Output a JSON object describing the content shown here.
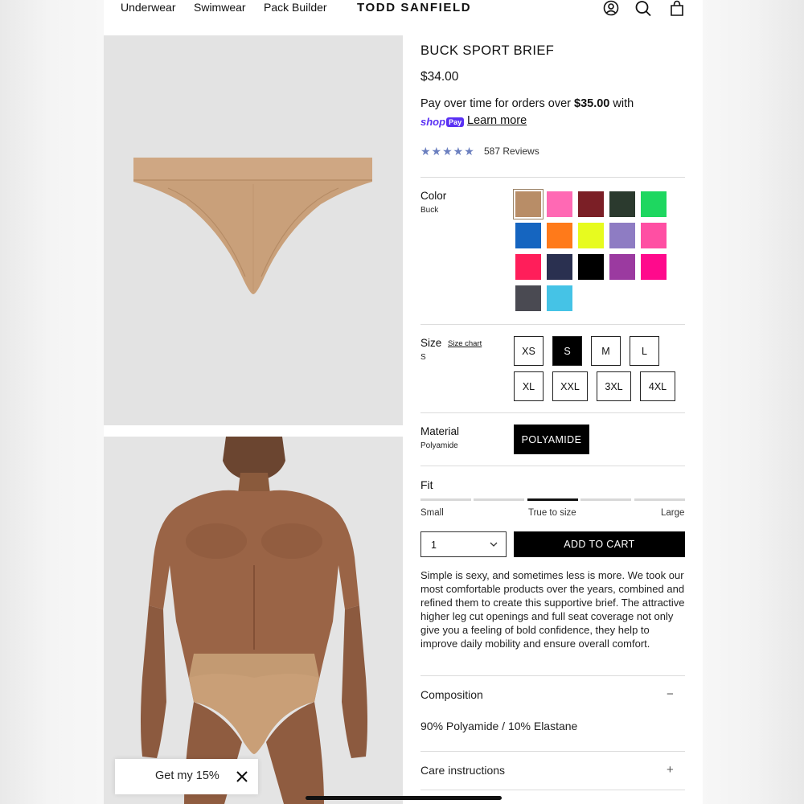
{
  "header": {
    "nav": [
      "Underwear",
      "Swimwear",
      "Pack Builder"
    ],
    "brand": "TODD SANFIELD",
    "icons": [
      "account-icon",
      "search-icon",
      "cart-icon"
    ]
  },
  "product": {
    "title": "BUCK SPORT BRIEF",
    "price": "$34.00",
    "shoppay_text_1": "Pay over time for orders over ",
    "shoppay_amount": "$35.00",
    "shoppay_text_2": " with",
    "shoppay_brand": "shop",
    "shoppay_badge": "Pay",
    "learn_more": "Learn more",
    "stars": "★★★★★",
    "rating": 5,
    "reviews": "587 Reviews"
  },
  "color": {
    "label": "Color",
    "value": "Buck",
    "swatches": [
      "#b88d67",
      "#ff69b4",
      "#7b1f26",
      "#2b3a2e",
      "#1ed760",
      "#1565c0",
      "#ff7a1a",
      "#e7fb1f",
      "#8e7cc3",
      "#ff4fa3",
      "#ff1e5a",
      "#2a3050",
      "#000000",
      "#9b3aa0",
      "#ff0a8c",
      "#4a4a52",
      "#45c3e6"
    ]
  },
  "size": {
    "label": "Size",
    "value": "S",
    "size_chart": "Size chart",
    "options": [
      "XS",
      "S",
      "M",
      "L",
      "XL",
      "XXL",
      "3XL",
      "4XL"
    ],
    "selected": "S"
  },
  "material": {
    "label": "Material",
    "value": "Polyamide",
    "option": "POLYAMIDE"
  },
  "fit": {
    "label": "Fit",
    "small": "Small",
    "middle": "True to size",
    "large": "Large",
    "active_segment": 3,
    "segments": 5
  },
  "purchase": {
    "quantity": "1",
    "add_to_cart": "ADD TO CART"
  },
  "description": "Simple is sexy, and sometimes less is more. We took our most comfortable products over the years, combined and refined them to create this supportive brief. The attractive higher leg cut openings and full seat coverage not only give you a feeling of bold confidence, they help to improve daily mobility and ensure overall comfort.",
  "accordions": {
    "composition_title": "Composition",
    "composition_sign": "−",
    "composition_text": "90% Polyamide / 10% Elastane",
    "care_title": "Care instructions",
    "care_sign": "+"
  },
  "promo": {
    "text": "Get my 15%"
  }
}
